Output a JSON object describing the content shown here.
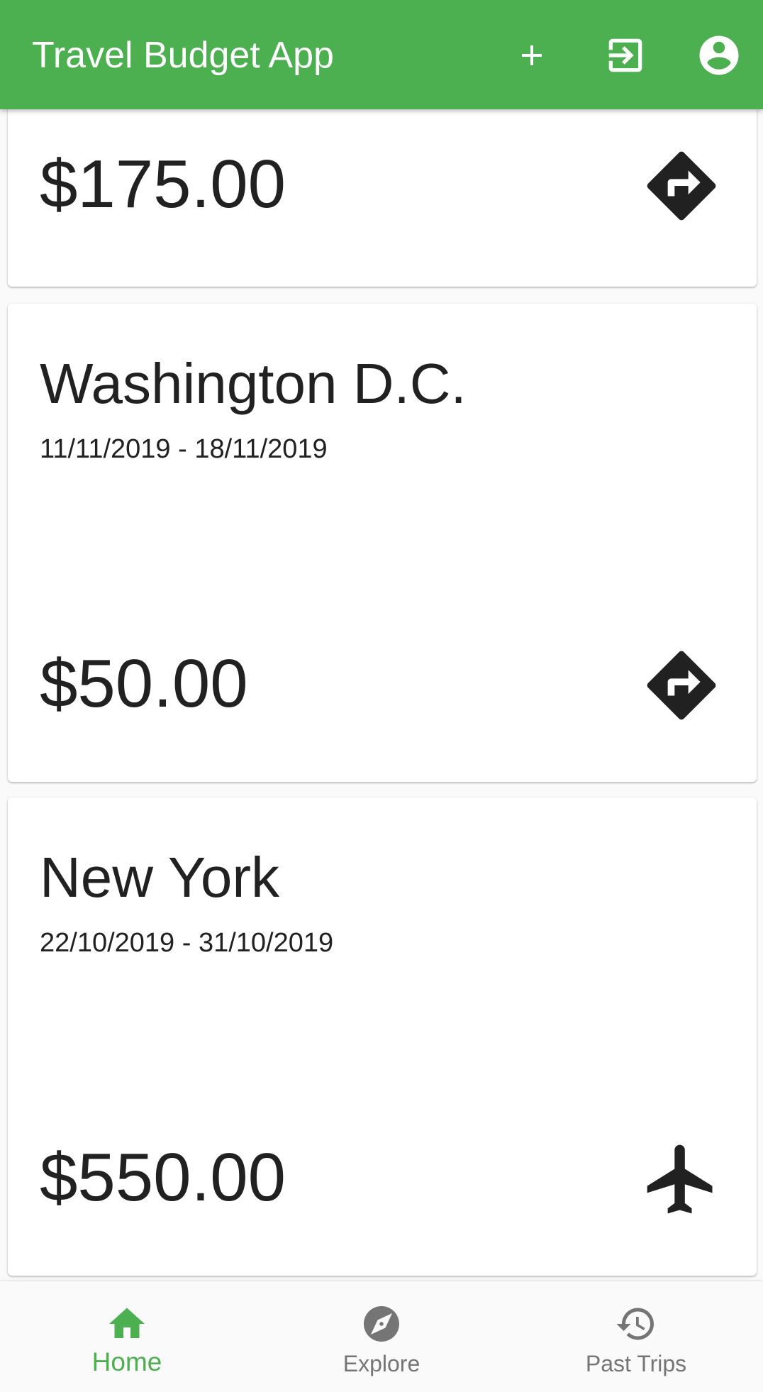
{
  "app": {
    "title": "Travel Budget App",
    "accent_color": "#4caf50",
    "header_icons": [
      "add-icon",
      "logout-icon",
      "account-circle-icon"
    ]
  },
  "trips": [
    {
      "amount": "$175.00",
      "icon": "directions-icon"
    },
    {
      "name": "Washington D.C.",
      "dates": "11/11/2019 - 18/11/2019",
      "amount": "$50.00",
      "icon": "directions-icon"
    },
    {
      "name": "New York",
      "dates": "22/10/2019 - 31/10/2019",
      "amount": "$550.00",
      "icon": "flight-icon"
    }
  ],
  "nav": {
    "active_color": "#4caf50",
    "inactive_color": "#757575",
    "items": [
      {
        "label": "Home",
        "icon": "home-icon",
        "active": true
      },
      {
        "label": "Explore",
        "icon": "explore-icon",
        "active": false
      },
      {
        "label": "Past Trips",
        "icon": "history-icon",
        "active": false
      }
    ]
  }
}
